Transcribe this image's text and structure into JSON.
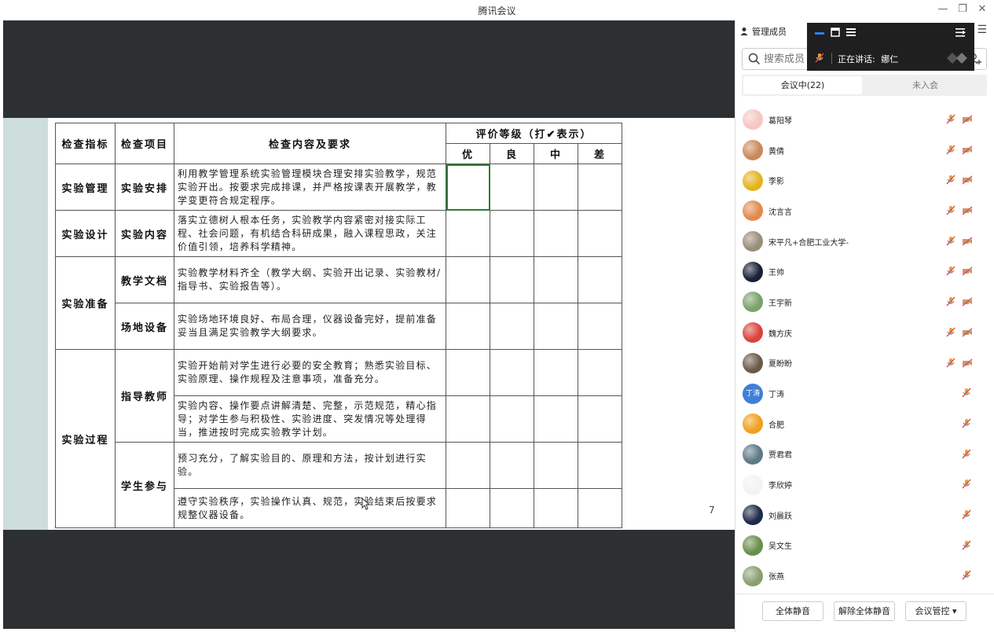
{
  "window": {
    "title": "腾讯会议",
    "min_label": "—",
    "restore_label": "❐",
    "close_label": "✕"
  },
  "slide": {
    "page_number": "7",
    "table": {
      "headers": {
        "indicator": "检查指标",
        "item": "检查项目",
        "content": "检查内容及要求",
        "grade": "评价等级（打✔表示）",
        "grades": [
          "优",
          "良",
          "中",
          "差"
        ]
      },
      "groups": [
        {
          "indicator": "实验管理",
          "items": [
            {
              "item": "实验安排",
              "content": "利用教学管理系统实验管理模块合理安排实验教学，规范实验开出。按要求完成排课，并严格按课表开展教学，教学变更符合规定程序。"
            }
          ]
        },
        {
          "indicator": "实验设计",
          "items": [
            {
              "item": "实验内容",
              "content": "落实立德树人根本任务，实验教学内容紧密对接实际工程、社会问题，有机结合科研成果，融入课程思政，关注价值引领，培养科学精神。"
            }
          ]
        },
        {
          "indicator": "实验准备",
          "items": [
            {
              "item": "教学文档",
              "content": "实验教学材料齐全（教学大纲、实验开出记录、实验教材/指导书、实验报告等）。"
            },
            {
              "item": "场地设备",
              "content": "实验场地环境良好、布局合理，仪器设备完好，提前准备妥当且满足实验教学大纲要求。"
            }
          ]
        },
        {
          "indicator": "实验过程",
          "items": [
            {
              "item": "指导教师",
              "content": "实验开始前对学生进行必要的安全教育；熟悉实验目标、实验原理、操作规程及注意事项，准备充分。"
            },
            {
              "item": "",
              "content": "实验内容、操作要点讲解清楚、完整，示范规范，精心指导；对学生参与积极性、实验进度、突发情况等处理得当，推进按时完成实验教学计划。"
            },
            {
              "item": "学生参与",
              "content": "预习充分，了解实验目的、原理和方法，按计划进行实验。"
            },
            {
              "item": "",
              "content": "遵守实验秩序，实验操作认真、规范，实验结束后按要求规整仪器设备。"
            }
          ]
        }
      ]
    }
  },
  "panel": {
    "title": "管理成员",
    "search_placeholder": "搜索成员",
    "tabs": {
      "in_meeting": "会议中(22)",
      "not_joined": "未入会"
    },
    "members": [
      {
        "name": "葛阳琴",
        "avatar": "#f4c7c3",
        "cam": true
      },
      {
        "name": "黄倩",
        "avatar": "#c98a5a",
        "cam": true
      },
      {
        "name": "李影",
        "avatar": "#e5b31f",
        "cam": true
      },
      {
        "name": "沈言言",
        "avatar": "#e28a4e",
        "cam": true
      },
      {
        "name": "宋平凡+合肥工业大学-",
        "avatar": "#9b8d7c",
        "cam": true
      },
      {
        "name": "王帅",
        "avatar": "#1a2036",
        "cam": true
      },
      {
        "name": "王宇新",
        "avatar": "#7aa26a",
        "cam": true
      },
      {
        "name": "魏方庆",
        "avatar": "#d9443c",
        "cam": true
      },
      {
        "name": "夏盼盼",
        "avatar": "#6b5a48",
        "cam": true
      },
      {
        "name": "丁涛",
        "avatar": "#3f7fd6",
        "cam": false,
        "initials": "丁涛"
      },
      {
        "name": "合肥",
        "avatar": "#f0a020",
        "cam": false
      },
      {
        "name": "贾君君",
        "avatar": "#5f7a86",
        "cam": false
      },
      {
        "name": "李欣婷",
        "avatar": "#f3f3f3",
        "cam": false
      },
      {
        "name": "刘晨跃",
        "avatar": "#1e2a4a",
        "cam": false
      },
      {
        "name": "吴文生",
        "avatar": "#6a8f4a",
        "cam": false
      },
      {
        "name": "张燕",
        "avatar": "#8aa070",
        "cam": false
      }
    ],
    "footer": {
      "mute_all": "全体静音",
      "unmute_all": "解除全体静音",
      "control": "会议管控 ▾"
    }
  },
  "floatbar": {
    "speaking_label": "正在讲话:",
    "speaker": "娜仁"
  }
}
